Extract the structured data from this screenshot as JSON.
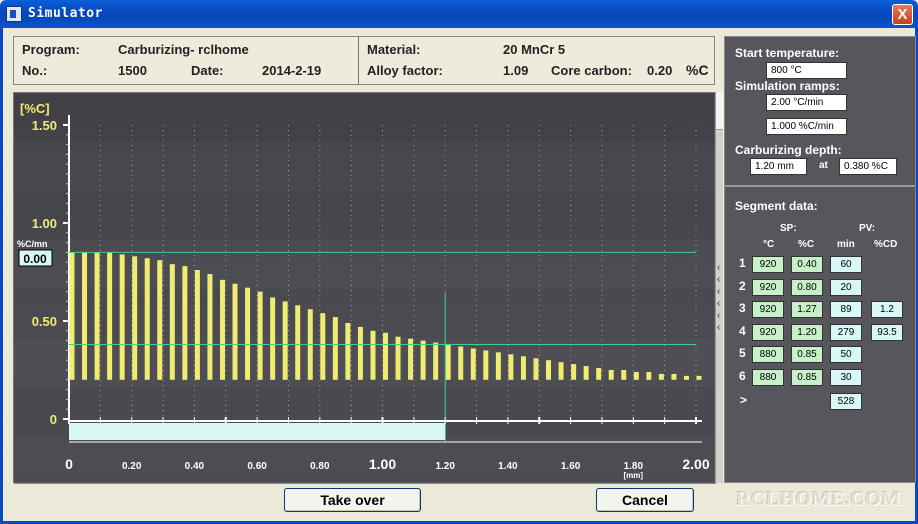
{
  "window": {
    "title": "Simulator",
    "close_label": "X"
  },
  "header": {
    "program_label": "Program:",
    "program_value": "Carburizing- rclhome",
    "no_label": "No.:",
    "no_value": "1500",
    "date_label": "Date:",
    "date_value": "2014-2-19",
    "material_label": "Material:",
    "material_value": "20 MnCr 5",
    "alloy_label": "Alloy factor:",
    "alloy_value": "1.09",
    "core_label": "Core carbon:",
    "core_value": "0.20",
    "unit": "%C"
  },
  "simulation": {
    "start_temp_label": "Start temperature:",
    "start_temp_value": "800 °C",
    "ramps_label": "Simulation ramps:",
    "ramp_temp_value": "2.00 °C/min",
    "ramp_carbon_value": "1.000 %C/min",
    "depth_label": "Carburizing depth:",
    "depth_value": "1.20 mm",
    "depth_at": "at",
    "depth_carbon_value": "0.380 %C"
  },
  "segments": {
    "title": "Segment data:",
    "sp_label": "SP:",
    "pv_label": "PV:",
    "col_temp": "°C",
    "col_c": "%C",
    "col_min": "min",
    "col_cd": "%CD",
    "rows": [
      {
        "num": "1",
        "temp": "920",
        "c": "0.40",
        "min": "60",
        "cd": ""
      },
      {
        "num": "2",
        "temp": "920",
        "c": "0.80",
        "min": "20",
        "cd": ""
      },
      {
        "num": "3",
        "temp": "920",
        "c": "1.27",
        "min": "89",
        "cd": "1.2"
      },
      {
        "num": "4",
        "temp": "920",
        "c": "1.20",
        "min": "279",
        "cd": "93.5"
      },
      {
        "num": "5",
        "temp": "880",
        "c": "0.85",
        "min": "50",
        "cd": ""
      },
      {
        "num": "6",
        "temp": "880",
        "c": "0.85",
        "min": "30",
        "cd": ""
      }
    ],
    "total_marker": ">",
    "total_min": "528"
  },
  "buttons": {
    "take_over": "Take over",
    "cancel": "Cancel"
  },
  "watermark": "RCLHOME.COM",
  "chart_data": {
    "type": "bar",
    "ylabel": "[%C]",
    "xlabel": "[mm]",
    "ylim": [
      0,
      1.5
    ],
    "xlim": [
      0,
      2.0
    ],
    "y_ticks": [
      "1.50",
      "1.00",
      "0.50",
      "0"
    ],
    "x_ticks": [
      "0",
      "0.20",
      "0.40",
      "0.60",
      "0.80",
      "1.00",
      "1.20",
      "1.40",
      "1.60",
      "1.80",
      "2.00"
    ],
    "rate_label": "%C/mn",
    "rate_value": "0.00",
    "x": [
      0.0,
      0.04,
      0.08,
      0.12,
      0.16,
      0.2,
      0.24,
      0.28,
      0.32,
      0.36,
      0.4,
      0.44,
      0.48,
      0.52,
      0.56,
      0.6,
      0.64,
      0.68,
      0.72,
      0.76,
      0.8,
      0.84,
      0.88,
      0.92,
      0.96,
      1.0,
      1.04,
      1.08,
      1.12,
      1.16,
      1.2,
      1.24,
      1.28,
      1.32,
      1.36,
      1.4,
      1.44,
      1.48,
      1.52,
      1.56,
      1.6,
      1.64,
      1.68,
      1.72,
      1.76,
      1.8,
      1.84,
      1.88,
      1.92,
      1.96,
      2.0
    ],
    "values": [
      0.85,
      0.85,
      0.85,
      0.85,
      0.84,
      0.83,
      0.82,
      0.81,
      0.79,
      0.78,
      0.76,
      0.74,
      0.71,
      0.69,
      0.67,
      0.65,
      0.62,
      0.6,
      0.58,
      0.56,
      0.54,
      0.52,
      0.49,
      0.47,
      0.45,
      0.44,
      0.42,
      0.41,
      0.4,
      0.39,
      0.38,
      0.37,
      0.36,
      0.35,
      0.34,
      0.33,
      0.32,
      0.31,
      0.3,
      0.29,
      0.28,
      0.27,
      0.26,
      0.25,
      0.25,
      0.24,
      0.24,
      0.23,
      0.23,
      0.22,
      0.22
    ],
    "reference_lines": {
      "surface_carbon": 0.85,
      "target_carbon": 0.38,
      "depth_mm": 1.2,
      "core_carbon": 0.2
    },
    "colors": {
      "bars": "#f0ec72",
      "reference": "#3fcf8e",
      "axis_text": "#f0ec72",
      "progress": "#d8f8f8"
    },
    "progress_fraction": 0.6
  }
}
